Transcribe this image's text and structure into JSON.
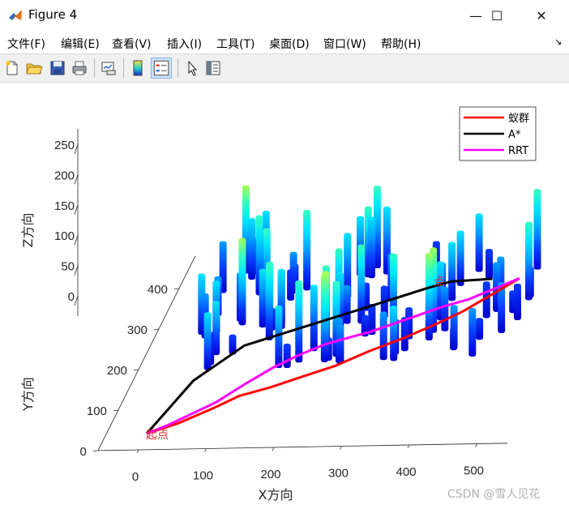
{
  "window": {
    "title": "Figure 4",
    "controls": {
      "minimize": "—",
      "maximize": "☐",
      "close": "✕"
    }
  },
  "menu": {
    "items": [
      "文件(F)",
      "编辑(E)",
      "查看(V)",
      "插入(I)",
      "工具(T)",
      "桌面(D)",
      "窗口(W)",
      "帮助(H)"
    ],
    "overflow_icon": "↘"
  },
  "toolbar": {
    "buttons": [
      "new-figure-icon",
      "open-file-icon",
      "save-icon",
      "print-icon",
      "link-plot-icon",
      "colorbar-icon",
      "legend-icon",
      "pointer-icon",
      "property-editor-icon"
    ],
    "active": "legend-icon"
  },
  "chart_data": {
    "type": "line",
    "projection": "3d",
    "title": "",
    "xlabel": "X方向",
    "ylabel": "Y方向",
    "zlabel": "Z方向",
    "xlim": [
      0,
      500
    ],
    "ylim": [
      0,
      400
    ],
    "zlim": [
      0,
      250
    ],
    "xticks": [
      "0",
      "100",
      "200",
      "300",
      "400",
      "500"
    ],
    "yticks": [
      "0",
      "100",
      "200",
      "300",
      "400"
    ],
    "zticks": [
      "0",
      "50",
      "100",
      "150",
      "200",
      "250"
    ],
    "legend": {
      "position": "top-right",
      "entries": [
        "蚁群",
        "A*",
        "RRT"
      ]
    },
    "series": [
      {
        "name": "蚁群",
        "color": "#ff0000",
        "x": [
          0,
          40,
          80,
          110,
          150,
          190,
          230,
          270,
          310,
          350,
          380,
          410,
          440
        ],
        "y": [
          0,
          25,
          60,
          90,
          110,
          135,
          160,
          195,
          225,
          260,
          290,
          330,
          370
        ],
        "z": [
          0,
          0,
          0,
          0,
          0,
          0,
          0,
          0,
          0,
          0,
          0,
          0,
          0
        ]
      },
      {
        "name": "A*",
        "color": "#000000",
        "x": [
          0,
          30,
          80,
          140,
          200,
          260,
          310,
          340,
          400
        ],
        "y": [
          0,
          130,
          215,
          250,
          285,
          320,
          350,
          365,
          370
        ],
        "z": [
          0,
          0,
          0,
          0,
          0,
          0,
          0,
          0,
          0
        ]
      },
      {
        "name": "RRT",
        "color": "#ff00ff",
        "x": [
          0,
          25,
          50,
          80,
          110,
          140,
          170,
          200,
          230,
          260,
          290,
          320,
          350,
          380,
          410,
          440
        ],
        "y": [
          0,
          20,
          45,
          75,
          120,
          160,
          190,
          215,
          230,
          245,
          265,
          285,
          305,
          320,
          345,
          370
        ],
        "z": [
          0,
          0,
          0,
          0,
          0,
          0,
          0,
          0,
          0,
          0,
          0,
          0,
          0,
          0,
          0,
          0
        ]
      }
    ],
    "annotations": [
      "起点",
      "点"
    ],
    "obstacles_colormap": [
      "#0000cc",
      "#0a3cff",
      "#00a0ff",
      "#00e5ff",
      "#35ffc0",
      "#a8ff55"
    ]
  },
  "watermark": "CSDN @雪人见花"
}
